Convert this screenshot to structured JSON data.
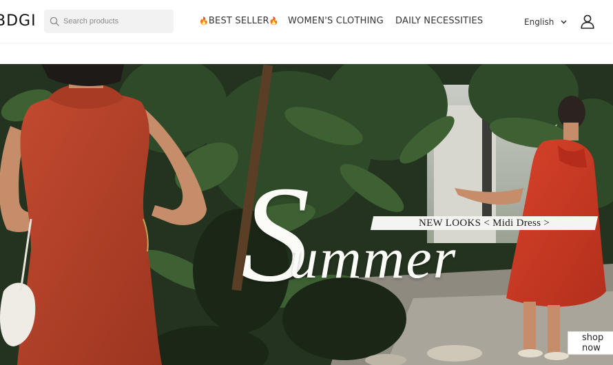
{
  "header": {
    "logo": "BDGI",
    "search_placeholder": "Search products",
    "nav": {
      "fire_emoji": "🔥",
      "best_seller": "BEST SELLER",
      "womens_clothing": "WOMEN'S CLOTHING",
      "daily_necessities": "DAILY NECESSITIES"
    },
    "language": "English"
  },
  "hero": {
    "banner_text": "NEW LOOKS < Midi Dress >",
    "headline_initial": "S",
    "headline_rest": "ummer",
    "cta": "shop now"
  },
  "icons": [
    "search-icon",
    "chevron-down-icon",
    "user-icon"
  ],
  "colors": {
    "accent_red": "#b8402a",
    "banner_bg": "#f4f4f2",
    "foliage": "#2b3a26"
  }
}
